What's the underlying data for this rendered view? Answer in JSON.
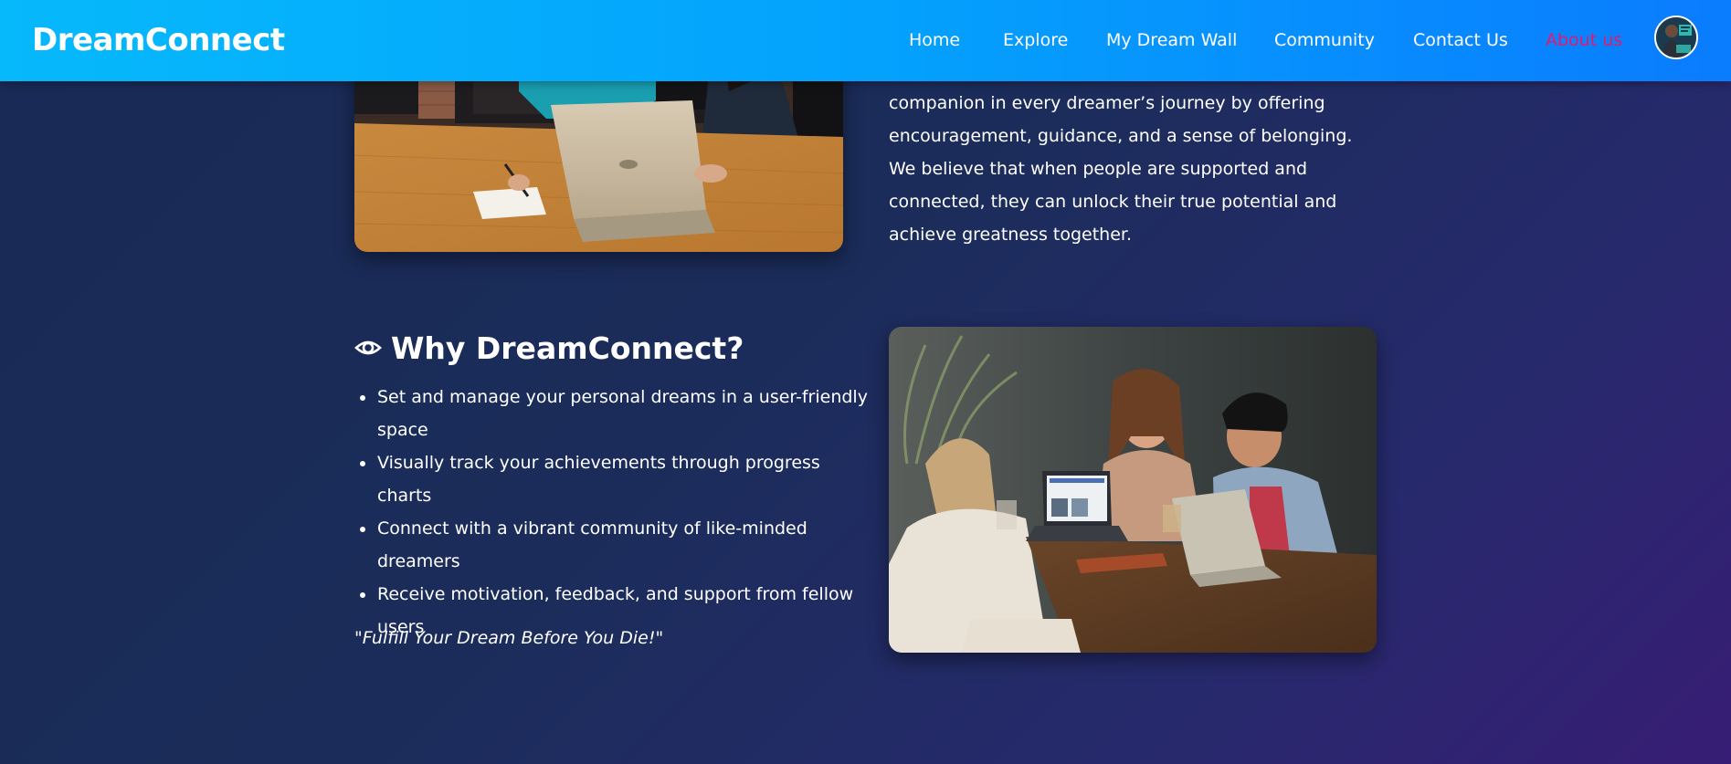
{
  "navbar": {
    "brand": "DreamConnect",
    "links": [
      {
        "label": "Home",
        "active": false
      },
      {
        "label": "Explore",
        "active": false
      },
      {
        "label": "My Dream Wall",
        "active": false
      },
      {
        "label": "Community",
        "active": false
      },
      {
        "label": "Contact Us",
        "active": false
      },
      {
        "label": "About us",
        "active": true
      }
    ],
    "avatar_icon": "user-avatar-icon"
  },
  "mission": {
    "text": "companion in every dreamer’s journey by offering encouragement, guidance, and a sense of belonging. We believe that when people are supported and connected, they can unlock their true potential and achieve greatness together."
  },
  "why": {
    "icon": "eye-icon",
    "title": "Why DreamConnect?",
    "features": [
      "Set and manage your personal dreams in a user-friendly space",
      "Visually track your achievements through progress charts",
      "Connect with a vibrant community of like-minded dreamers",
      "Receive motivation, feedback, and support from fellow users"
    ],
    "tagline": "\"Fulfill Your Dream Before You Die!\""
  },
  "colors": {
    "nav_gradient_start": "#06b9fb",
    "nav_gradient_end": "#0a7cfe",
    "active_link": "#e6196a",
    "page_bg_start": "#192a55",
    "page_bg_end": "#371d75"
  }
}
